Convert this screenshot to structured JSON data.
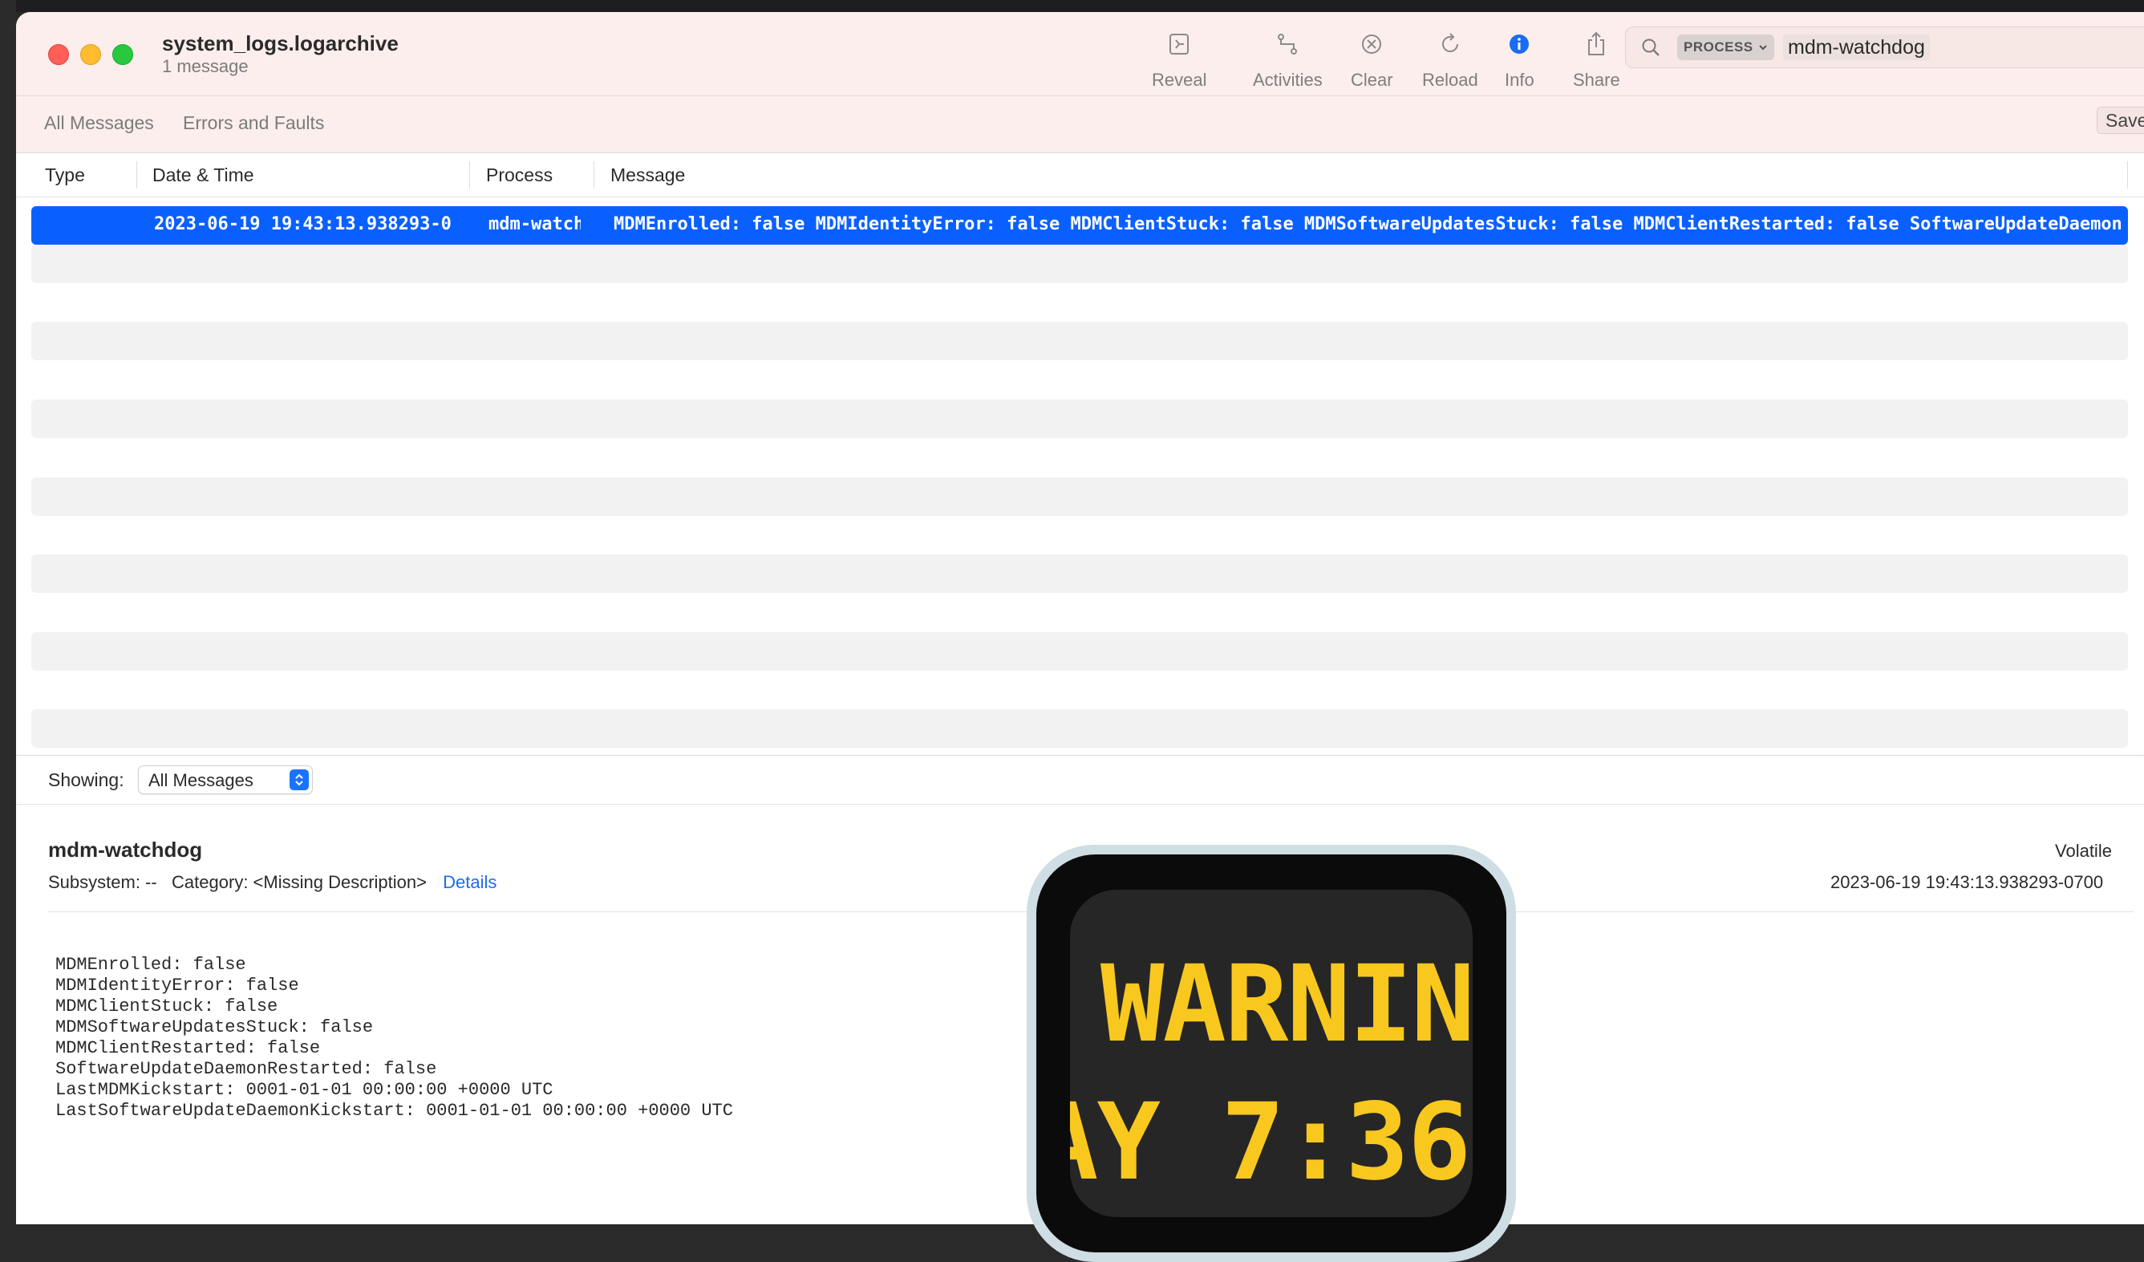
{
  "window": {
    "title": "system_logs.logarchive",
    "subtitle": "1 message"
  },
  "toolbar": {
    "reveal_label": "Reveal",
    "activities_label": "Activities",
    "clear_label": "Clear",
    "reload_label": "Reload",
    "info_label": "Info",
    "share_label": "Share"
  },
  "search": {
    "token_label": "PROCESS",
    "query": "mdm-watchdog"
  },
  "scope": {
    "items": [
      "All Messages",
      "Errors and Faults"
    ],
    "save_label": "Save"
  },
  "columns": {
    "type": "Type",
    "datetime": "Date & Time",
    "process": "Process",
    "message": "Message"
  },
  "rows": [
    {
      "datetime": "2023-06-19 19:43:13.938293-0",
      "process": "mdm-watchdog",
      "message": "MDMEnrolled: false MDMIdentityError: false MDMClientStuck: false MDMSoftwareUpdatesStuck: false MDMClientRestarted: false SoftwareUpdateDaemonRestarted: false"
    }
  ],
  "showing": {
    "label": "Showing:",
    "value": "All Messages"
  },
  "detail": {
    "process": "mdm-watchdog",
    "subsystem_label": "Subsystem: --",
    "category_label": "Category: <Missing Description>",
    "details_link": "Details",
    "volatile": "Volatile",
    "timestamp": "2023-06-19 19:43:13.938293-0700",
    "lines": [
      "MDMEnrolled: false",
      "MDMIdentityError: false",
      "MDMClientStuck: false",
      "MDMSoftwareUpdatesStuck: false",
      "MDMClientRestarted: false",
      "SoftwareUpdateDaemonRestarted: false",
      "LastMDMKickstart: 0001-01-01 00:00:00 +0000 UTC",
      "LastSoftwareUpdateDaemonKickstart: 0001-01-01 00:00:00 +0000 UTC"
    ]
  },
  "overlay": {
    "line1": "WARNIN",
    "line2": "AY 7:36"
  },
  "colors": {
    "selection": "#0a60ff",
    "link": "#1a6cf0",
    "overlay_text": "#f9c81e",
    "titlebar": "#fbeeec"
  }
}
